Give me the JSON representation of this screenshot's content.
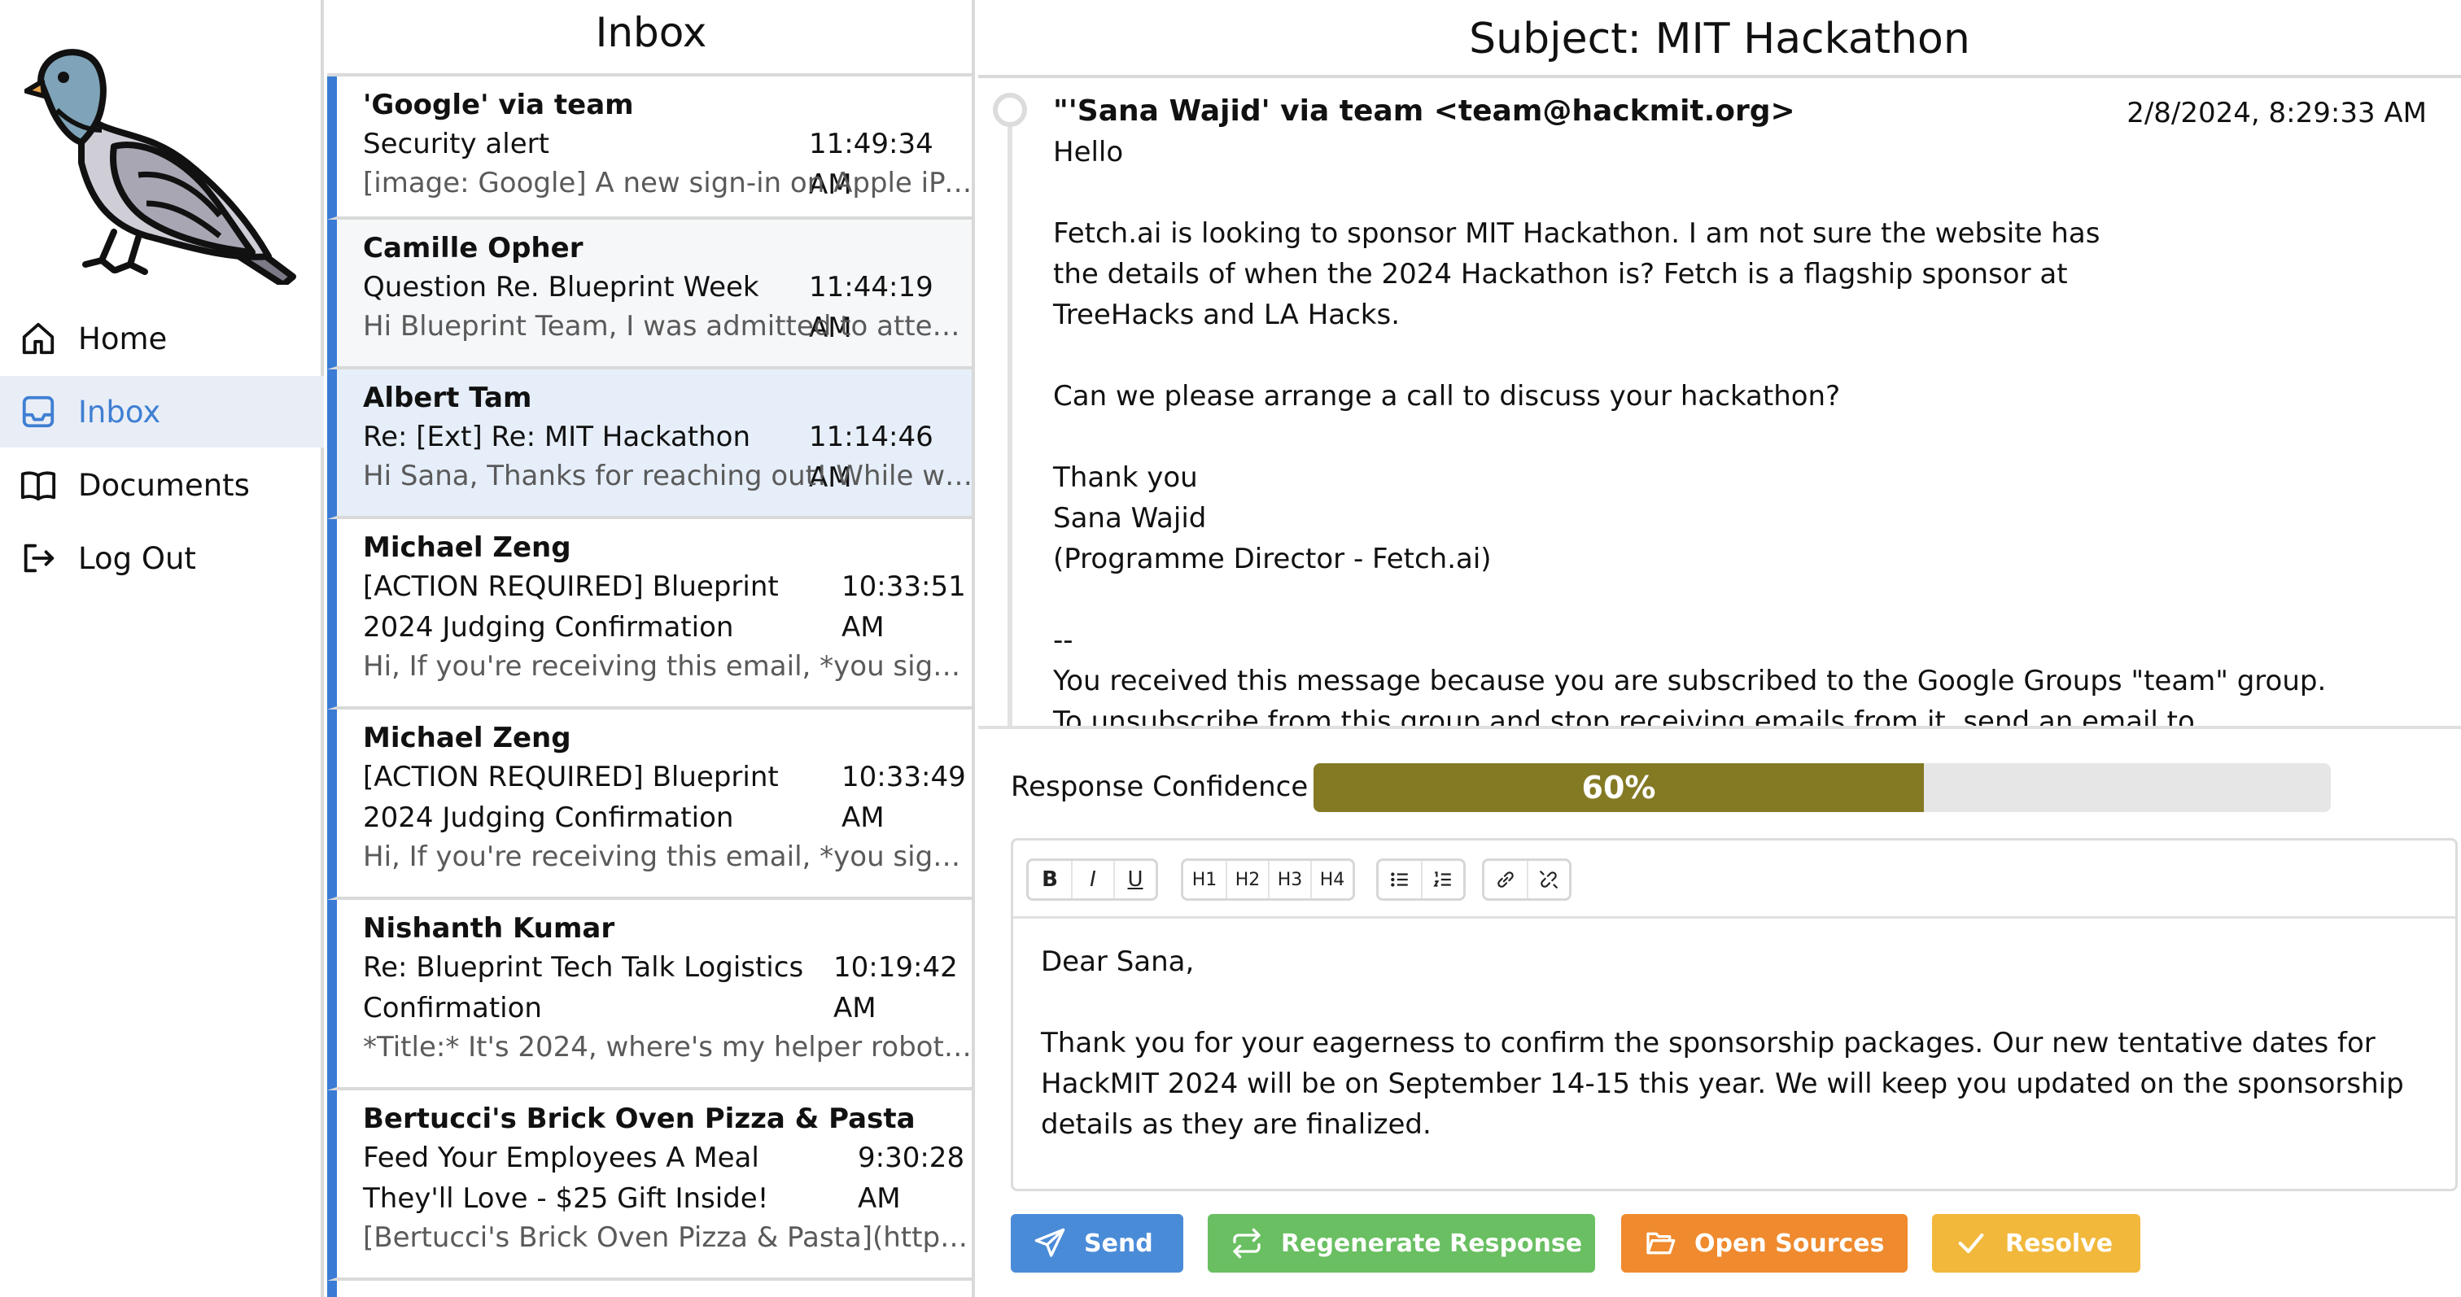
{
  "nav": {
    "items": [
      {
        "label": "Home",
        "icon": "home-icon"
      },
      {
        "label": "Inbox",
        "icon": "inbox-icon",
        "active": true
      },
      {
        "label": "Documents",
        "icon": "book-icon"
      },
      {
        "label": "Log Out",
        "icon": "logout-icon"
      }
    ]
  },
  "inbox": {
    "title": "Inbox",
    "emails": [
      {
        "sender": "'Google' via team",
        "subject": "Security alert",
        "time": "11:49:34 AM",
        "snippet": "[image: Google] A new sign-in on Apple iPa…"
      },
      {
        "sender": "Camille Opher",
        "subject": "Question Re. Blueprint Week",
        "time": "11:44:19 AM",
        "snippet": "Hi Blueprint Team, I was admitted to atten…"
      },
      {
        "sender": "Albert Tam",
        "subject": "Re: [Ext] Re: MIT Hackathon",
        "time": "11:14:46 AM",
        "snippet": "Hi Sana, Thanks for reaching out! While we…"
      },
      {
        "sender": "Michael Zeng",
        "subject": "[ACTION REQUIRED] Blueprint 2024 Judging Confirmation",
        "time": "10:33:51 AM",
        "snippet": "Hi, If you're receiving this email, *you sign…"
      },
      {
        "sender": "Michael Zeng",
        "subject": "[ACTION REQUIRED] Blueprint 2024 Judging Confirmation",
        "time": "10:33:49 AM",
        "snippet": "Hi, If you're receiving this email, *you sign…"
      },
      {
        "sender": "Nishanth Kumar",
        "subject": "Re: Blueprint Tech Talk Logistics Confirmation",
        "time": "10:19:42 AM",
        "snippet": "*Title:* It's 2024, where's my helper robot…"
      },
      {
        "sender": "Bertucci's Brick Oven Pizza & Pasta",
        "subject": "Feed Your Employees A Meal They'll Love - $25 Gift Inside!",
        "time": "9:30:28 AM",
        "snippet": "[Bertucci's Brick Oven Pizza & Pasta](https…"
      }
    ]
  },
  "message": {
    "subject": "Subject: MIT Hackathon",
    "from": "\"'Sana Wajid' via team <team@hackmit.org>",
    "date": "2/8/2024, 8:29:33 AM",
    "body_lines": [
      "Hello",
      "",
      "Fetch.ai is looking to sponsor MIT Hackathon. I am not sure the website has",
      "the details of when the 2024 Hackathon is? Fetch is a flagship sponsor at",
      "TreeHacks and LA Hacks.",
      "",
      "Can we please arrange a call to discuss your hackathon?",
      "",
      "Thank you",
      "Sana Wajid",
      "(Programme Director - Fetch.ai)",
      "",
      "--",
      "You received this message because you are subscribed to the Google Groups \"team\" group.",
      "To unsubscribe from this group and stop receiving emails from it, send an email to"
    ]
  },
  "confidence": {
    "label": "Response Confidence",
    "value": 60,
    "text": "60%",
    "color": "#847a24"
  },
  "editor": {
    "toolbar": [
      "B",
      "I",
      "U",
      "H1",
      "H2",
      "H3",
      "H4"
    ],
    "lines": [
      "Dear Sana,",
      "",
      "Thank you for your eagerness to confirm the sponsorship packages. Our new tentative dates for",
      "HackMIT 2024 will be on September 14-15 this year. We will keep you updated on the sponsorship",
      "details as they are finalized."
    ]
  },
  "actions": {
    "send": "Send",
    "regenerate": "Regenerate Response",
    "open_sources": "Open Sources",
    "resolve": "Resolve",
    "colors": {
      "send": "#4a8bd8",
      "regenerate": "#69bf62",
      "open_sources": "#ef8a2e",
      "resolve": "#f2b83c"
    }
  }
}
